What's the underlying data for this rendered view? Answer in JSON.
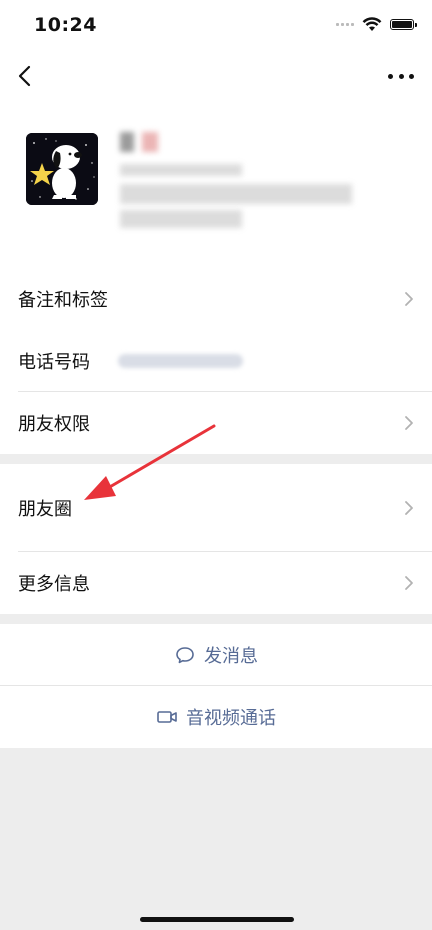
{
  "status_bar": {
    "time": "10:24"
  },
  "profile_rows": {
    "remark_tags": "备注和标签",
    "phone": "电话号码",
    "friend_permissions": "朋友权限"
  },
  "moments_rows": {
    "moments": "朋友圈",
    "more_info": "更多信息"
  },
  "actions": {
    "send_message": "发消息",
    "video_call": "音视频通话"
  },
  "colors": {
    "link": "#576b95",
    "annotation_arrow": "#e8333a",
    "background": "#ededed"
  }
}
